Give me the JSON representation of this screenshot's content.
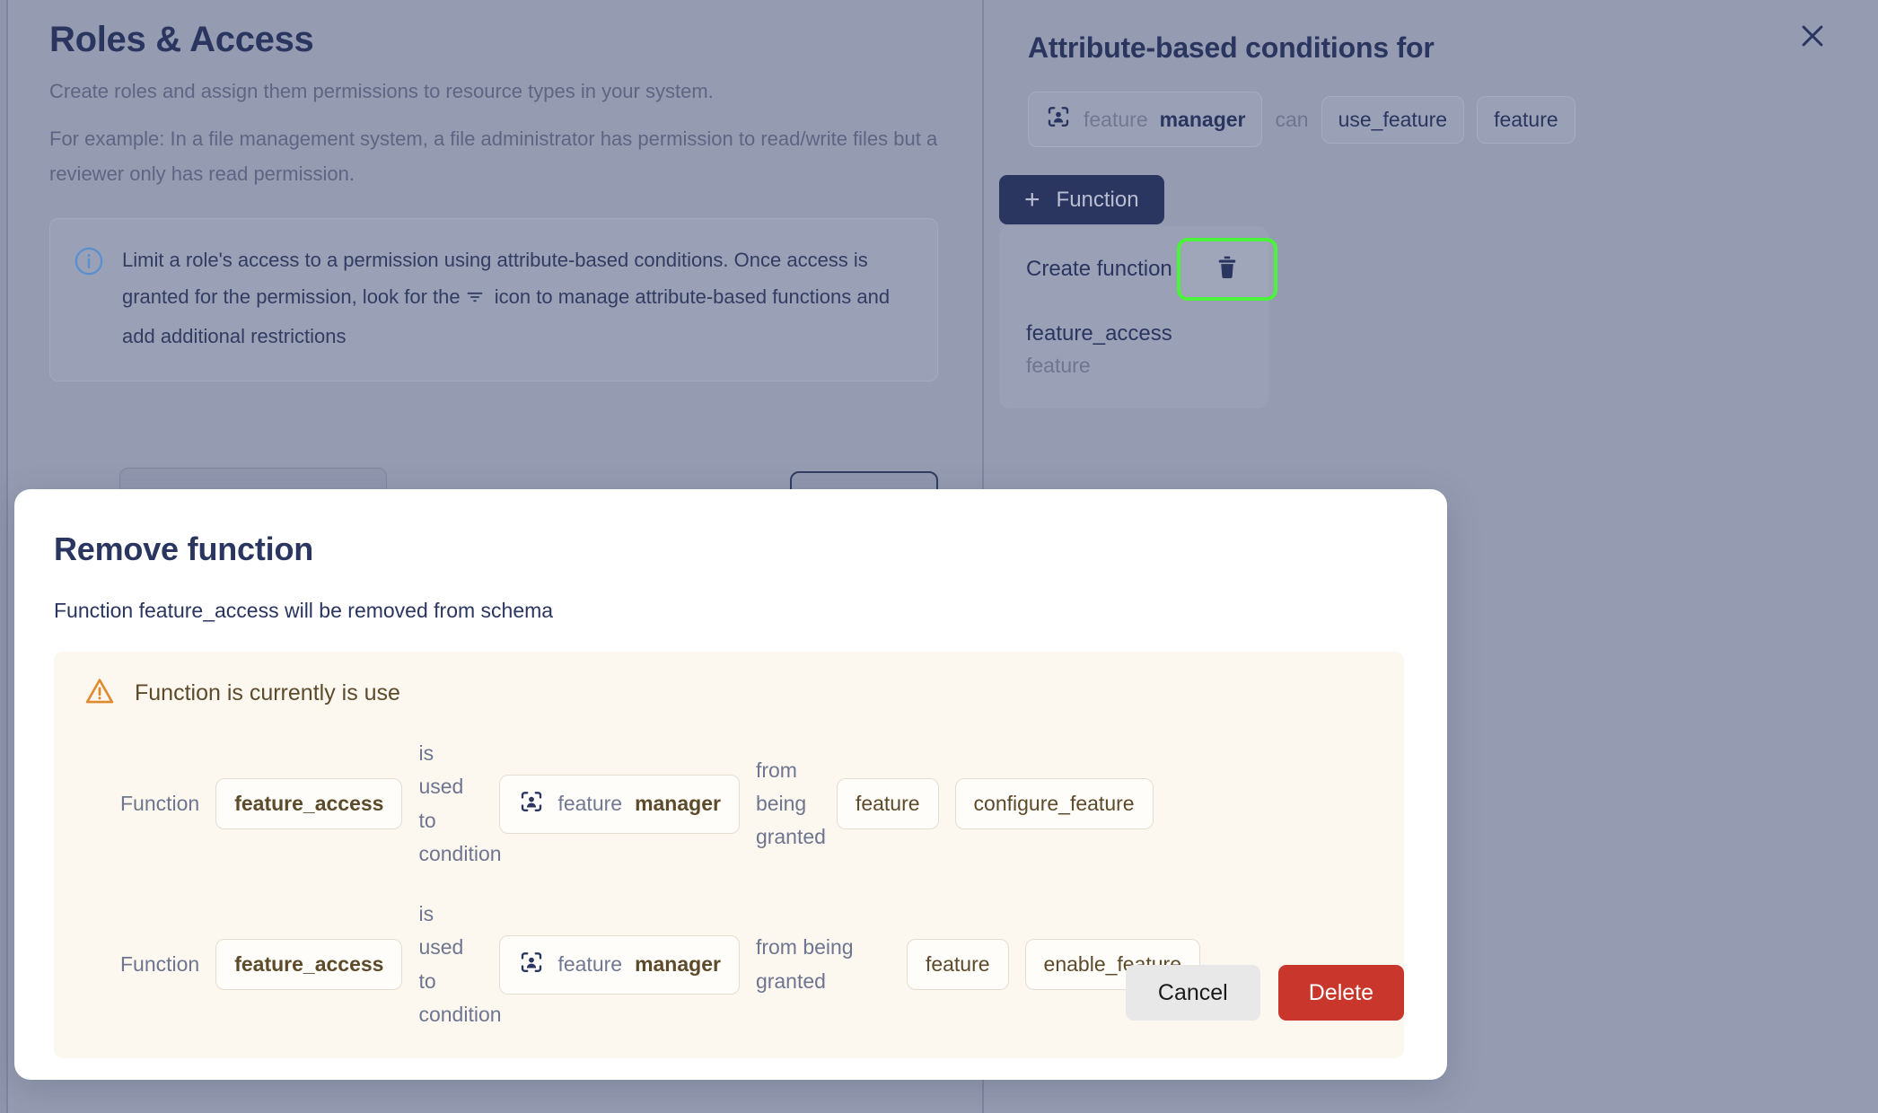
{
  "background": {
    "left_panel": {
      "title": "Roles & Access",
      "lead1": "Create roles and assign them permissions to resource types in your system.",
      "lead2": "For example: In a file management system, a file administrator has permission to read/write files but a reviewer only has read permission.",
      "callout": {
        "icon": "info-icon",
        "text_before": "Limit a role's access to a permission using attribute-based conditions. Once access is granted for the permission, look for the",
        "icon_inline": "filter-icon",
        "text_after": "icon to manage attribute-based functions and add additional restrictions"
      }
    },
    "right_panel": {
      "title": "Attribute-based conditions for",
      "close_icon": "close-icon",
      "rule": {
        "subject_icon": "user-scan-icon",
        "subject_resource": "feature",
        "subject_role": "manager",
        "connector": "can",
        "action": "use_feature",
        "resource": "feature"
      },
      "function_button": {
        "plus": "+",
        "label": "Function"
      },
      "menu": {
        "create_label": "Create function",
        "function_name": "feature_access",
        "function_resource": "feature",
        "delete_icon": "trash-icon"
      }
    }
  },
  "modal": {
    "title": "Remove function",
    "subtitle": "Function feature_access will be removed from schema",
    "warning": {
      "icon": "warning-triangle-icon",
      "text": "Function is currently is use"
    },
    "usages": [
      {
        "label": "Function",
        "function": "feature_access",
        "connector1": "is used to condition",
        "subject_icon": "user-scan-icon",
        "subject_resource": "feature",
        "subject_role": "manager",
        "connector2": "from being granted",
        "resource": "feature",
        "action": "configure_feature"
      },
      {
        "label": "Function",
        "function": "feature_access",
        "connector1": "is used to condition",
        "subject_icon": "user-scan-icon",
        "subject_resource": "feature",
        "subject_role": "manager",
        "connector2": "from being granted",
        "resource": "feature",
        "action": "enable_feature"
      }
    ],
    "footer": {
      "cancel_label": "Cancel",
      "delete_label": "Delete"
    }
  },
  "colors": {
    "backdrop": "#959cb2",
    "navy": "#2a3560",
    "danger": "#c9372c",
    "warning_bg": "#fdf8ef",
    "warning_accent": "#e08a30",
    "highlight_green": "#4cf33c"
  }
}
